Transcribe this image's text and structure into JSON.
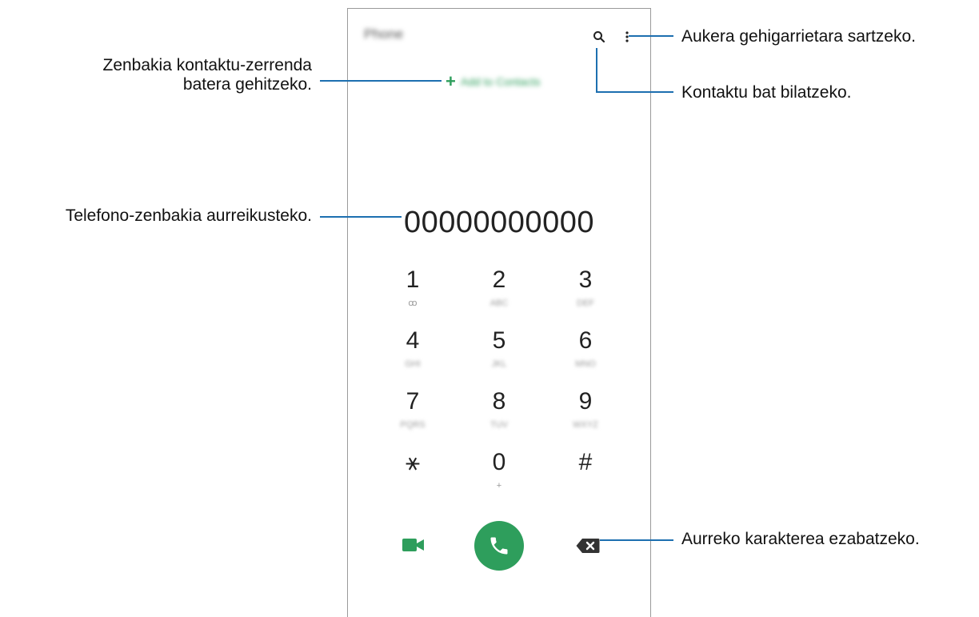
{
  "app": {
    "title": "Phone",
    "add_contact_label": "Add to Contacts",
    "number": "00000000000"
  },
  "keypad": [
    {
      "digit": "1",
      "sub": "ꝏ"
    },
    {
      "digit": "2",
      "sub": "ABC"
    },
    {
      "digit": "3",
      "sub": "DEF"
    },
    {
      "digit": "4",
      "sub": "GHI"
    },
    {
      "digit": "5",
      "sub": "JKL"
    },
    {
      "digit": "6",
      "sub": "MNO"
    },
    {
      "digit": "7",
      "sub": "PQRS"
    },
    {
      "digit": "8",
      "sub": "TUV"
    },
    {
      "digit": "9",
      "sub": "WXYZ"
    },
    {
      "digit": "⚹",
      "sub": ""
    },
    {
      "digit": "0",
      "sub": "+"
    },
    {
      "digit": "#",
      "sub": ""
    }
  ],
  "annotations": {
    "add_contact_line1": "Zenbakia kontaktu-zerrenda",
    "add_contact_line2": "batera gehitzeko.",
    "preview_number": "Telefono-zenbakia aurreikusteko.",
    "more_options": "Aukera gehigarrietara sartzeko.",
    "search_contact": "Kontaktu bat bilatzeko.",
    "delete_char": "Aurreko karakterea ezabatzeko."
  },
  "icons": {
    "search": "search-icon",
    "more": "more-options-icon",
    "video": "video-call-icon",
    "call": "phone-icon",
    "backspace": "backspace-icon"
  },
  "colors": {
    "accent_green": "#2e9e5c",
    "annotation_line": "#1d6fb0"
  }
}
